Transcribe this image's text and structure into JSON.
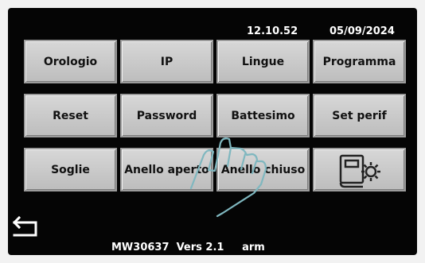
{
  "status": {
    "time": "12.10.52",
    "date": "05/09/2024"
  },
  "menu": {
    "row1": [
      "Orologio",
      "IP",
      "Lingue",
      "Programma"
    ],
    "row2": [
      "Reset",
      "Password",
      "Battesimo",
      "Set perif"
    ],
    "row3": [
      "Soglie",
      "Anello aperto",
      "Anello chiuso"
    ]
  },
  "footer": {
    "model": "MW30637",
    "version": "Vers 2.1",
    "platform": "arm"
  },
  "icons": {
    "back": "return-arrow-icon",
    "book_settings": "book-gear-icon",
    "touch": "hand-touch-icon"
  },
  "colors": {
    "screen_bg": "#050505",
    "button_bg": "#c9c9c9",
    "text_light": "#ffffff"
  }
}
